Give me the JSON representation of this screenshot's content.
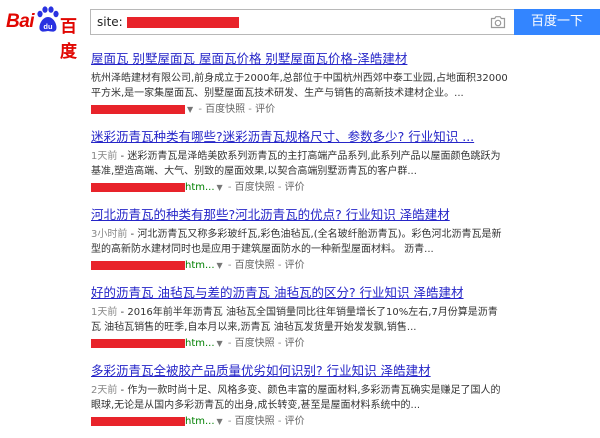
{
  "header": {
    "logo_bai": "Bai",
    "logo_du": "百度",
    "search_value": "site:",
    "search_button": "百度一下"
  },
  "results": [
    {
      "title": "屋面瓦 别墅屋面瓦 屋面瓦价格 别墅屋面瓦价格-泽皓建材",
      "abstract_lines": [
        "杭州泽皓建材有限公司,前身成立于2000年,总部位于中国杭州西郊中泰工业园,占地面积32000",
        "平方米,是一家集屋面瓦、别墅屋面瓦技术研发、生产与销售的高新技术建材企业。..."
      ],
      "url": "",
      "snapshot": "百度快照",
      "review": "评价"
    },
    {
      "title": "迷彩沥青瓦种类有哪些?迷彩沥青瓦规格尺寸、参数多少? 行业知识 ...",
      "date": "1天前",
      "abstract_lines": [
        " - 迷彩沥青瓦是泽皓美欧系列沥青瓦的主打高端产品系列,此系列产品以屋面颜色跳跃为",
        "基准,塑造高端、大气、别致的屋面效果,以契合高端别墅沥青瓦的客户群..."
      ],
      "url": "htm...",
      "snapshot": "百度快照",
      "review": "评价"
    },
    {
      "title": "河北沥青瓦的种类有那些?河北沥青瓦的优点? 行业知识 泽皓建材",
      "date": "3小时前",
      "abstract_lines": [
        " - 河北沥青瓦又称多彩玻纤瓦,彩色油毡瓦,(全名玻纤胎沥青瓦)。彩色河北沥青瓦是新",
        "型的高新防水建材同时也是应用于建筑屋面防水的一种新型屋面材料。 沥青..."
      ],
      "url": "htm...",
      "snapshot": "百度快照",
      "review": "评价"
    },
    {
      "title": "好的沥青瓦 油毡瓦与差的沥青瓦 油毡瓦的区分? 行业知识 泽皓建材",
      "date": "1天前",
      "abstract_lines": [
        " - 2016年前半年沥青瓦 油毡瓦全国销量同比往年销量增长了10%左右,7月份算是沥青",
        "瓦 油毡瓦销售的旺季,自本月以来,沥青瓦 油毡瓦发货量开始发发飘,销售..."
      ],
      "url": "htm...",
      "snapshot": "百度快照",
      "review": "评价"
    },
    {
      "title": "多彩沥青瓦全被胶产品质量优劣如何识别? 行业知识 泽皓建材",
      "date": "2天前",
      "abstract_lines": [
        " - 作为一款时尚十足、风格多变、颜色丰富的屋面材料,多彩沥青瓦确实是赚足了国人的",
        "眼球,无论是从国内多彩沥青瓦的出身,成长转变,甚至是屋面材料系统中的..."
      ],
      "url": "htm...",
      "snapshot": "百度快照",
      "review": "评价"
    }
  ]
}
